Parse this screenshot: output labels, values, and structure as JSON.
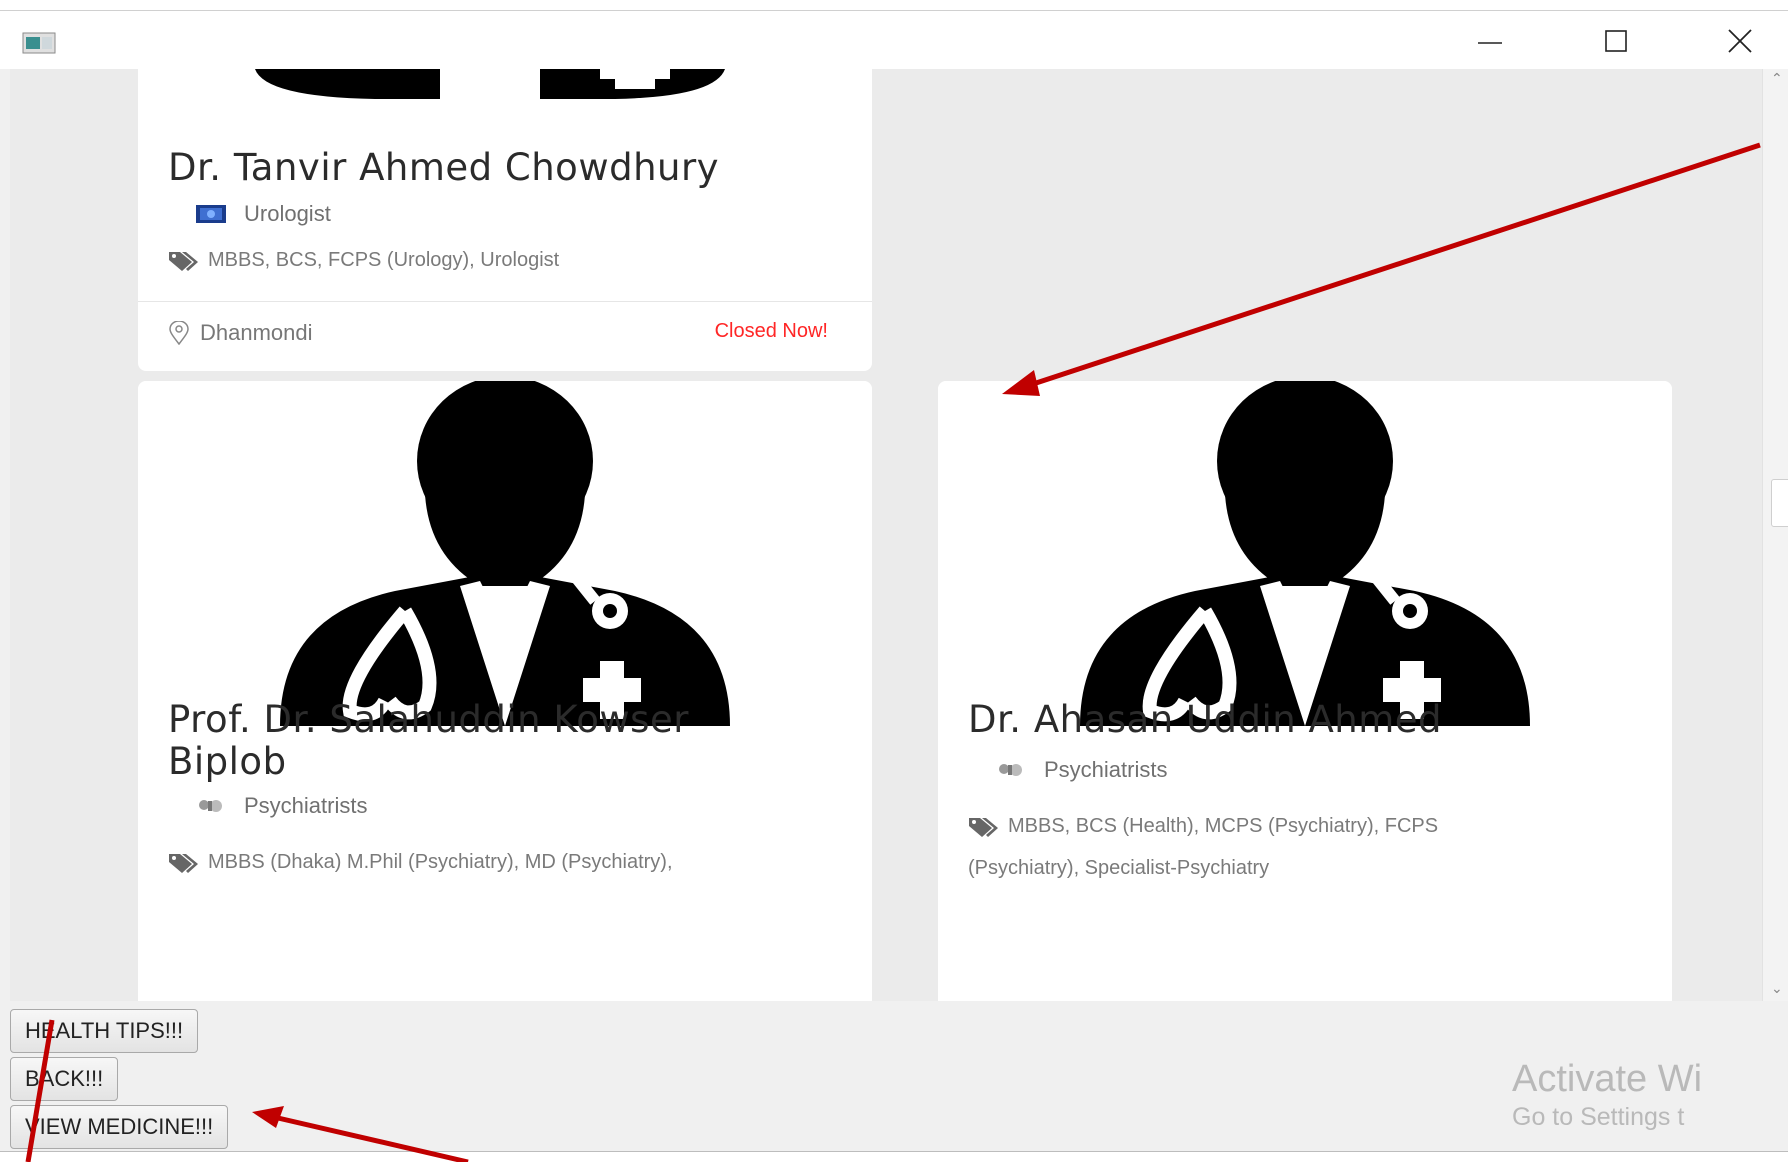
{
  "window": {
    "controls": {
      "minimize_icon": "minimize-icon",
      "maximize_icon": "maximize-icon",
      "close_icon": "close-icon"
    }
  },
  "doctors": [
    {
      "name": "Dr. Tanvir Ahmed Chowdhury",
      "specialty": "Urologist",
      "qualifications": "MBBS, BCS, FCPS (Urology), Urologist",
      "location": "Dhanmondi",
      "status": "Closed Now!"
    },
    {
      "name_line1": "Prof. Dr. Salahuddin Kowser",
      "name_line2": "Biplob",
      "specialty": "Psychiatrists",
      "qualifications": "MBBS (Dhaka) M.Phil (Psychiatry), MD (Psychiatry),"
    },
    {
      "name": "Dr. Ahasan Uddin Ahmed",
      "specialty": "Psychiatrists",
      "qualifications_line1": "MBBS, BCS (Health), MCPS (Psychiatry), FCPS",
      "qualifications_line2": "(Psychiatry), Specialist-Psychiatry"
    }
  ],
  "buttons": {
    "health_tips": "HEALTH  TIPS!!!",
    "back": "BACK!!!",
    "view_medicine": "VIEW MEDICINE!!!"
  },
  "watermark": {
    "title": "Activate Wi",
    "subtitle": "Go to Settings t"
  },
  "colors": {
    "status_closed": "#ff2626",
    "annotation_arrow": "#c00000"
  }
}
